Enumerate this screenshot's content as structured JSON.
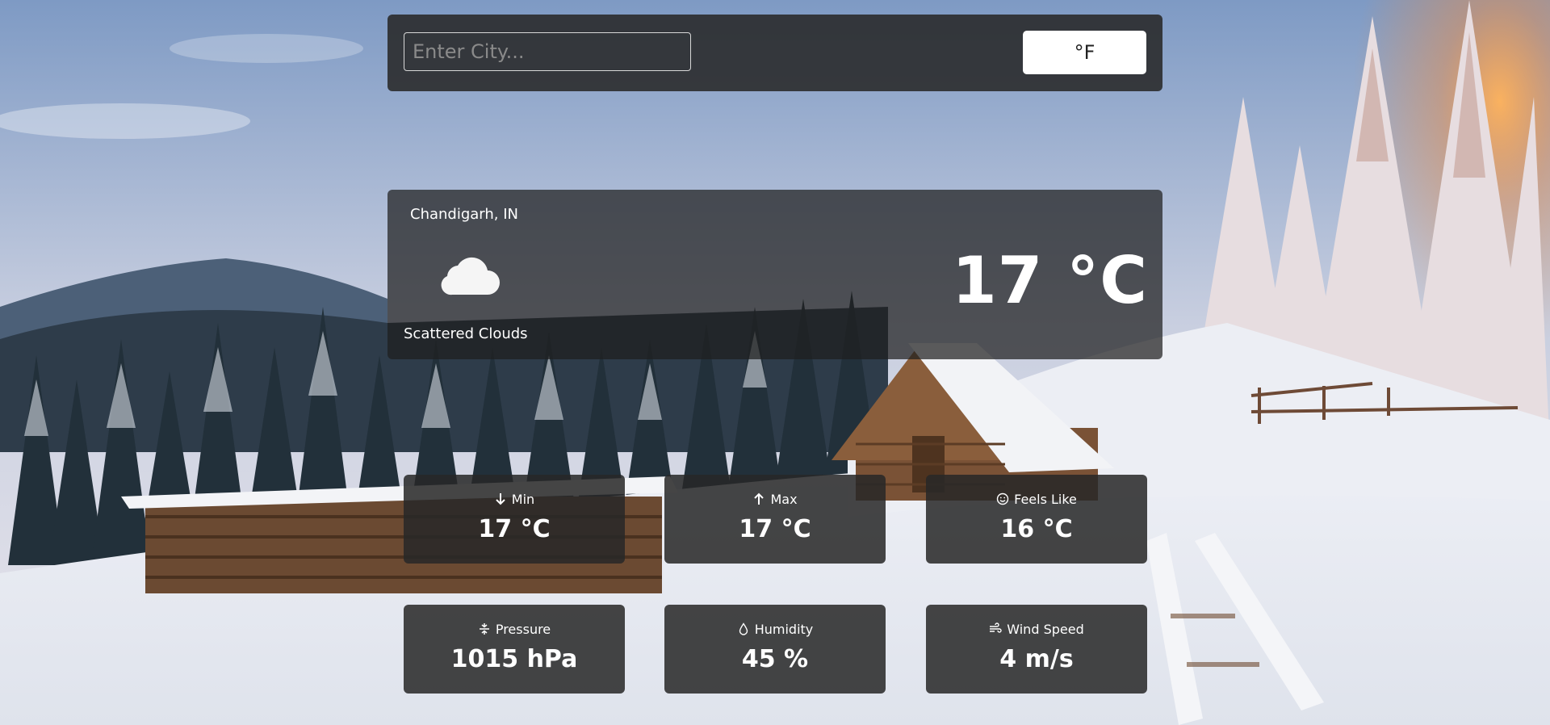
{
  "search": {
    "placeholder": "Enter City...",
    "value": ""
  },
  "unit_toggle": {
    "label": "°F"
  },
  "current": {
    "location": "Chandigarh, IN",
    "icon": "cloud-icon",
    "description": "Scattered Clouds",
    "temperature": "17 °C"
  },
  "stats": {
    "min": {
      "label": "Min",
      "value": "17 °C",
      "icon": "arrow-down-icon"
    },
    "max": {
      "label": "Max",
      "value": "17 °C",
      "icon": "arrow-up-icon"
    },
    "feels_like": {
      "label": "Feels Like",
      "value": "16 °C",
      "icon": "smile-icon"
    },
    "pressure": {
      "label": "Pressure",
      "value": "1015 hPa",
      "icon": "compress-icon"
    },
    "humidity": {
      "label": "Humidity",
      "value": "45 %",
      "icon": "droplet-icon"
    },
    "wind_speed": {
      "label": "Wind Speed",
      "value": "4 m/s",
      "icon": "wind-icon"
    }
  },
  "colors": {
    "panel": "#282828",
    "button_bg": "#ffffff",
    "text": "#ffffff"
  }
}
